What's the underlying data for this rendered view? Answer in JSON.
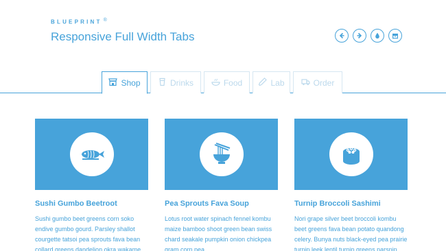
{
  "header": {
    "brand": "BLUEPRINT",
    "brand_mark": "®",
    "title": "Responsive Full Width Tabs"
  },
  "nav_icons": [
    "arrow-left-icon",
    "arrow-right-icon",
    "drop-icon",
    "archive-icon"
  ],
  "tabs": [
    {
      "label": "Shop",
      "icon": "shop-icon",
      "active": true
    },
    {
      "label": "Drinks",
      "icon": "cup-icon",
      "active": false
    },
    {
      "label": "Food",
      "icon": "food-icon",
      "active": false
    },
    {
      "label": "Lab",
      "icon": "lab-icon",
      "active": false
    },
    {
      "label": "Order",
      "icon": "truck-icon",
      "active": false
    }
  ],
  "cards": [
    {
      "title": "Sushi Gumbo Beetroot",
      "icon": "fish-icon",
      "text": "Sushi gumbo beet greens corn soko endive gumbo gourd. Parsley shallot courgette tatsoi pea sprouts fava bean collard greens dandelion okra wakame"
    },
    {
      "title": "Pea Sprouts Fava Soup",
      "icon": "noodle-bowl-icon",
      "text": "Lotus root water spinach fennel kombu maize bamboo shoot green bean swiss chard seakale pumpkin onion chickpea gram corn pea."
    },
    {
      "title": "Turnip Broccoli Sashimi",
      "icon": "sushi-icon",
      "text": "Nori grape silver beet broccoli kombu beet greens fava bean potato quandong celery. Bunya nuts black-eyed pea prairie turnip leek lentil turnip greens parsnip."
    }
  ],
  "colors": {
    "accent": "#47a3da",
    "tab_inactive": "#bcd9ec",
    "background": "#ffffff"
  }
}
